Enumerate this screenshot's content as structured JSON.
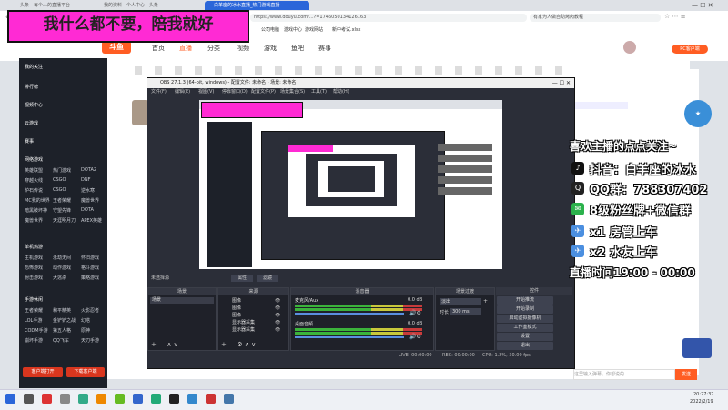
{
  "overlay_title": "我什么都不要，陪我就好",
  "browser": {
    "tabs": [
      {
        "label": "头条 - 每个人的直播平台"
      },
      {
        "label": "我的资料 - 个人中心 - 头条"
      },
      {
        "label": "白羊座的冰水直播_热门游戏直播"
      }
    ],
    "address_url": "https://www.douyu.com/...?=1746050134126163",
    "search_placeholder": "有家为人做自助烤肉教程",
    "bookmarks": [
      "公司电脑",
      "游戏中心",
      "游戏网站",
      "新中考试.xlsx"
    ]
  },
  "site": {
    "nav": [
      "首页",
      "直播",
      "分类",
      "视频",
      "游戏",
      "鱼吧",
      "赛事"
    ],
    "right_promo_btn": "PC客户端"
  },
  "left_panel": {
    "top": [
      "我的关注",
      "排行榜",
      "视频中心",
      "云游戏",
      "赛事"
    ],
    "section_online": "网络游戏",
    "online_games": [
      [
        "英雄联盟",
        "热门游戏",
        "DOTA2"
      ],
      [
        "穿越火线",
        "CSGO",
        "DNF"
      ],
      [
        "炉石传说",
        "CSGO",
        "逆水寒"
      ],
      [
        "MC我的世界",
        "王者荣耀",
        "魔兽世界"
      ],
      [
        "暗黑破坏神",
        "守望先锋",
        "DOTA"
      ],
      [
        "魔兽世界",
        "天涯明月刀",
        "APEX英雄"
      ]
    ],
    "section_single": "单机热游",
    "single_games": [
      [
        "主机游戏",
        "永劫无间",
        "怀旧游戏"
      ],
      [
        "恐怖游戏",
        "动作游戏",
        "格斗游戏"
      ],
      [
        "射击游戏",
        "大逃杀",
        "策略游戏"
      ]
    ],
    "section_mobile": "手游休闲",
    "mobile_games": [
      [
        "王者荣耀",
        "和平精英",
        "火影忍者"
      ],
      [
        "LOL手游",
        "金铲铲之战",
        "幻塔"
      ],
      [
        "CODM手游",
        "第五人格",
        "原神"
      ],
      [
        "崩坏手游",
        "QQ飞车",
        "天刀手游"
      ]
    ],
    "btn_client": "客户端打开",
    "btn_download": "下载客户端"
  },
  "obs": {
    "title": "OBS 27.1.3 (64-bit, windows) - 配置文件: 未命名 - 场景: 未命名",
    "menu": [
      "文件(F)",
      "编辑(E)",
      "视图(V)",
      "停靠窗口(D)",
      "配置文件(P)",
      "场景集合(S)",
      "工具(T)",
      "帮助(H)"
    ],
    "no_source_label": "未选择源",
    "properties_btn": "属性",
    "filters_btn": "滤镜",
    "docks": {
      "scenes": "场景",
      "sources": "来源",
      "mixer": "混音器",
      "transitions": "场景过渡",
      "controls": "控件"
    },
    "scene_items": [
      "场景"
    ],
    "source_items": [
      "图像",
      "图像",
      "图像",
      "显示器采集",
      "显示器采集"
    ],
    "mixer": [
      {
        "name": "麦克风/Aux",
        "db": "0.0 dB"
      },
      {
        "name": "桌面音频",
        "db": "0.0 dB"
      }
    ],
    "transition": {
      "type": "淡出",
      "duration_label": "时长",
      "duration_value": "300 ms"
    },
    "controls": [
      "开始推流",
      "开始录制",
      "启动虚拟摄像机",
      "工作室模式",
      "设置",
      "退出"
    ],
    "status": {
      "live": "LIVE: 00:00:00",
      "rec": "REC: 00:00:00",
      "cpu": "CPU: 1.2%, 30.00 fps"
    }
  },
  "promo_lines": [
    {
      "text": "喜欢主播的点点关注~",
      "icon": ""
    },
    {
      "text": "抖音：白羊座的冰水",
      "icon": "tiktok-icon"
    },
    {
      "text": "QQ群：788307402",
      "icon": "qq-icon"
    },
    {
      "text": "8级粉丝牌+微信群",
      "icon": "wechat-icon"
    },
    {
      "text": "x1 房管上车",
      "icon": "airplane-icon"
    },
    {
      "text": "x2 水友上车",
      "icon": "airplane-icon"
    },
    {
      "text": "直播时间19:00 - 00:00",
      "icon": ""
    }
  ],
  "chat": {
    "input_placeholder": "这里输入弹幕，你想说的……",
    "send": "发送"
  },
  "taskbar": {
    "time": "20:27:37",
    "date": "2022/2/19"
  },
  "colors": {
    "overlay_bg": "#ff2ad4",
    "obs_bg": "#2b2e38",
    "browser_accent": "#2b66d9",
    "site_accent": "#ff5d23"
  }
}
